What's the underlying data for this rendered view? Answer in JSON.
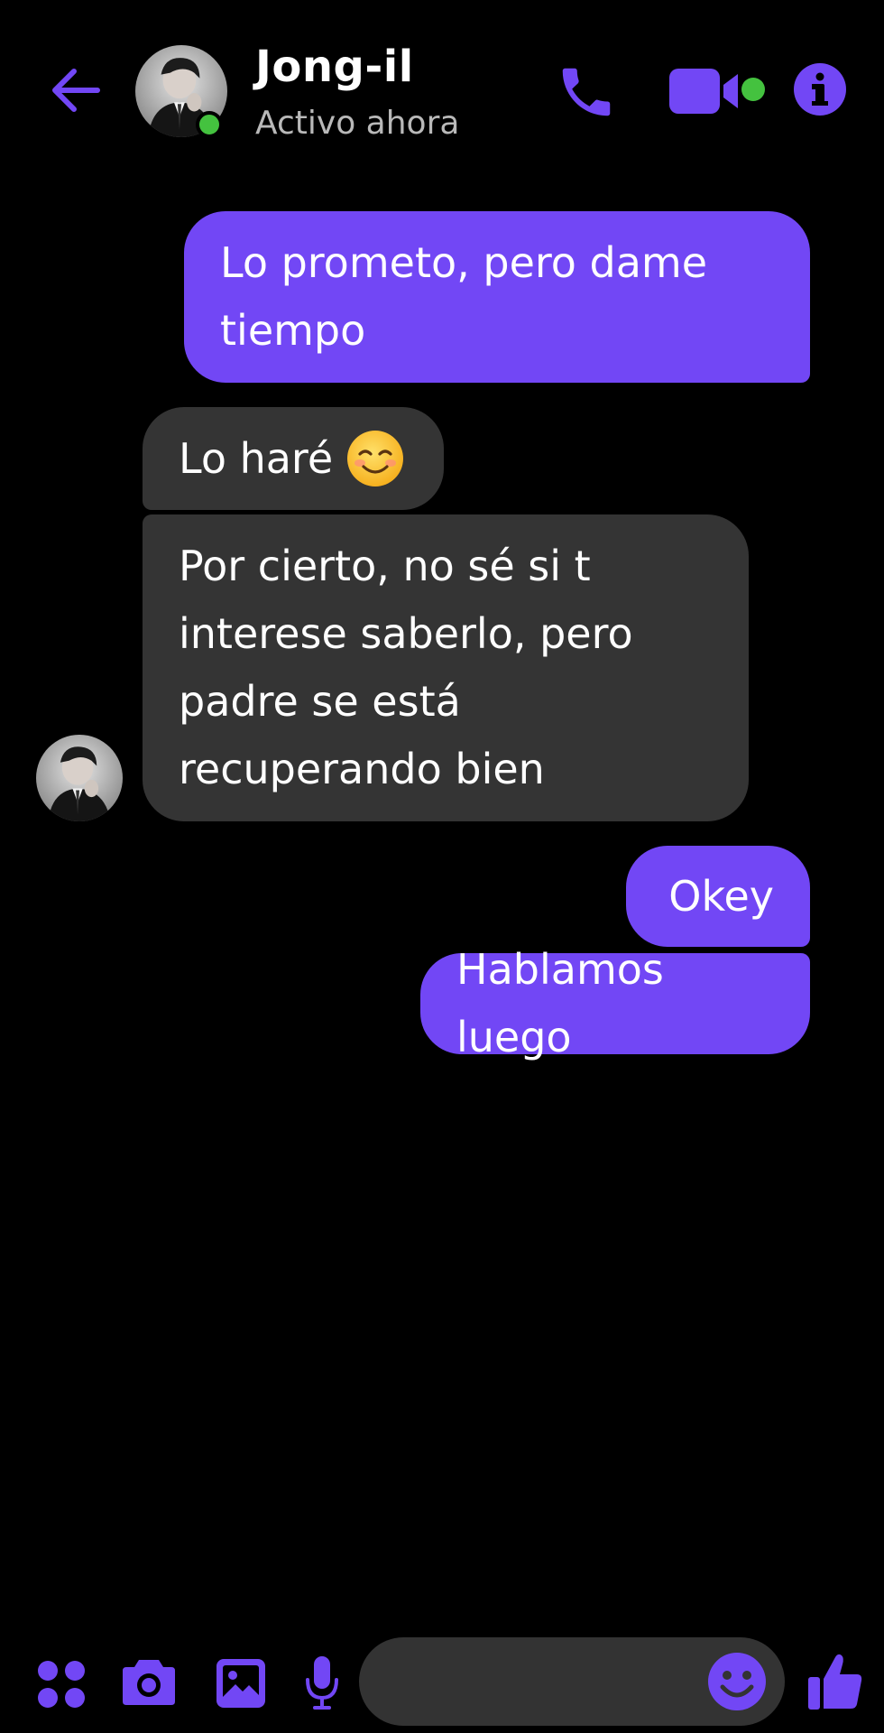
{
  "colors": {
    "accent": "#7247f5",
    "incoming_bubble": "#343434",
    "online": "#44c23f",
    "background": "#000000",
    "status_text": "#b9b9b9"
  },
  "header": {
    "contact_name": "Jong-il",
    "status": "Activo ahora",
    "icons": [
      "back-arrow-icon",
      "avatar",
      "online-dot",
      "phone-icon",
      "video-camera-icon",
      "info-icon"
    ]
  },
  "messages": [
    {
      "direction": "outgoing",
      "text": "Lo prometo, pero dame tiempo"
    },
    {
      "direction": "incoming",
      "text": "Lo haré",
      "emoji": "smiling-face-icon"
    },
    {
      "direction": "incoming",
      "text": "Por cierto, no sé si t interese saberlo, pero padre se está recuperando bien"
    },
    {
      "direction": "outgoing",
      "text": "Okey"
    },
    {
      "direction": "outgoing",
      "text": "Hablamos luego"
    }
  ],
  "composer": {
    "placeholder": "",
    "icons": [
      "apps-icon",
      "camera-icon",
      "gallery-icon",
      "microphone-icon",
      "emoji-icon",
      "thumbs-up-icon"
    ]
  }
}
